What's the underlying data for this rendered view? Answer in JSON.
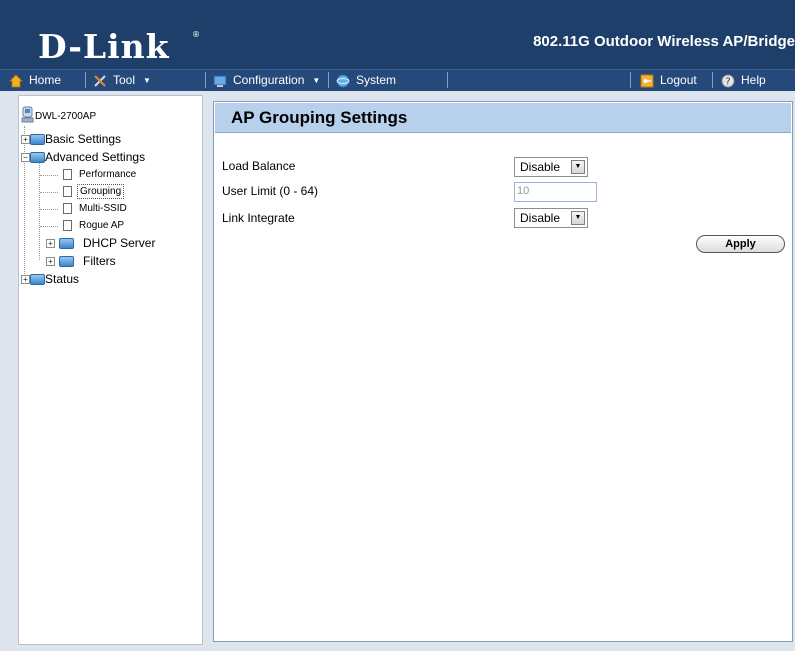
{
  "header": {
    "logo": "D-Link",
    "logo_mark": "®",
    "product": "802.11G Outdoor Wireless AP/Bridge"
  },
  "menu": {
    "home": "Home",
    "tool": "Tool",
    "configuration": "Configuration",
    "system": "System",
    "logout": "Logout",
    "help": "Help"
  },
  "tree": {
    "root": "DWL-2700AP",
    "basic": "Basic Settings",
    "advanced": "Advanced Settings",
    "performance": "Performance",
    "grouping": "Grouping",
    "multissid": "Multi-SSID",
    "rogue": "Rogue AP",
    "dhcp": "DHCP Server",
    "filters": "Filters",
    "status": "Status",
    "selected": "Grouping"
  },
  "content": {
    "title": "AP Grouping Settings",
    "load_balance_label": "Load Balance",
    "load_balance_value": "Disable",
    "user_limit_label": "User Limit (0 - 64)",
    "user_limit_value": "10",
    "link_integrate_label": "Link Integrate",
    "link_integrate_value": "Disable",
    "apply_label": "Apply"
  },
  "icons": {
    "home": "home-icon",
    "tool": "tool-icon",
    "configuration": "configuration-icon",
    "system": "system-icon",
    "logout": "logout-icon",
    "help": "help-icon",
    "device": "device-icon",
    "folder": "folder-icon",
    "page": "page-icon"
  },
  "colors": {
    "header_bg": "#1d3f69",
    "menu_bg": "#24497a",
    "title_bar": "#b7d1ec",
    "panel_border": "#7f9cc2"
  }
}
